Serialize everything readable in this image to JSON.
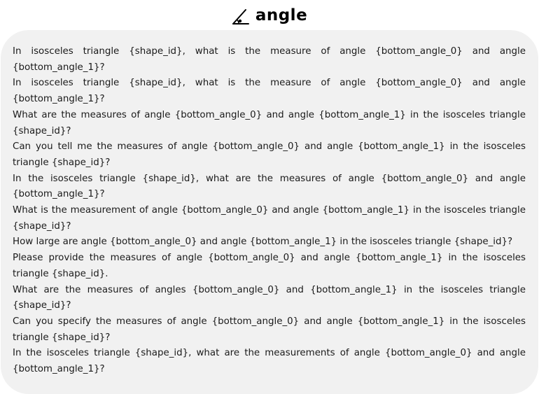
{
  "header": {
    "title": "angle",
    "icon": "angle-icon"
  },
  "questions": [
    "In isosceles triangle {shape_id}, what is the measure of angle {bottom_angle_0} and angle {bottom_angle_1}?",
    "In isosceles triangle {shape_id}, what is the measure of angle {bottom_angle_0} and angle {bottom_angle_1}?",
    "What are the measures of angle {bottom_angle_0} and angle {bottom_angle_1} in the isosceles triangle {shape_id}?",
    "Can you tell me the measures of angle {bottom_angle_0} and angle {bottom_angle_1} in the isosceles triangle {shape_id}?",
    "In the isosceles triangle {shape_id}, what are the measures of angle {bottom_angle_0} and angle {bottom_angle_1}?",
    "What is the measurement of angle {bottom_angle_0} and angle {bottom_angle_1} in the isosceles triangle {shape_id}?",
    "How large are angle {bottom_angle_0} and angle {bottom_angle_1} in the isosceles triangle {shape_id}?",
    "Please provide the measures of angle {bottom_angle_0} and angle {bottom_angle_1} in the isosceles triangle {shape_id}.",
    "What are the measures of angles {bottom_angle_0} and {bottom_angle_1} in the isosceles triangle {shape_id}?",
    "Can you specify the measures of angle {bottom_angle_0} and angle {bottom_angle_1} in the isosceles triangle {shape_id}?",
    "In the isosceles triangle {shape_id}, what are the measurements of angle {bottom_angle_0} and angle {bottom_angle_1}?"
  ]
}
